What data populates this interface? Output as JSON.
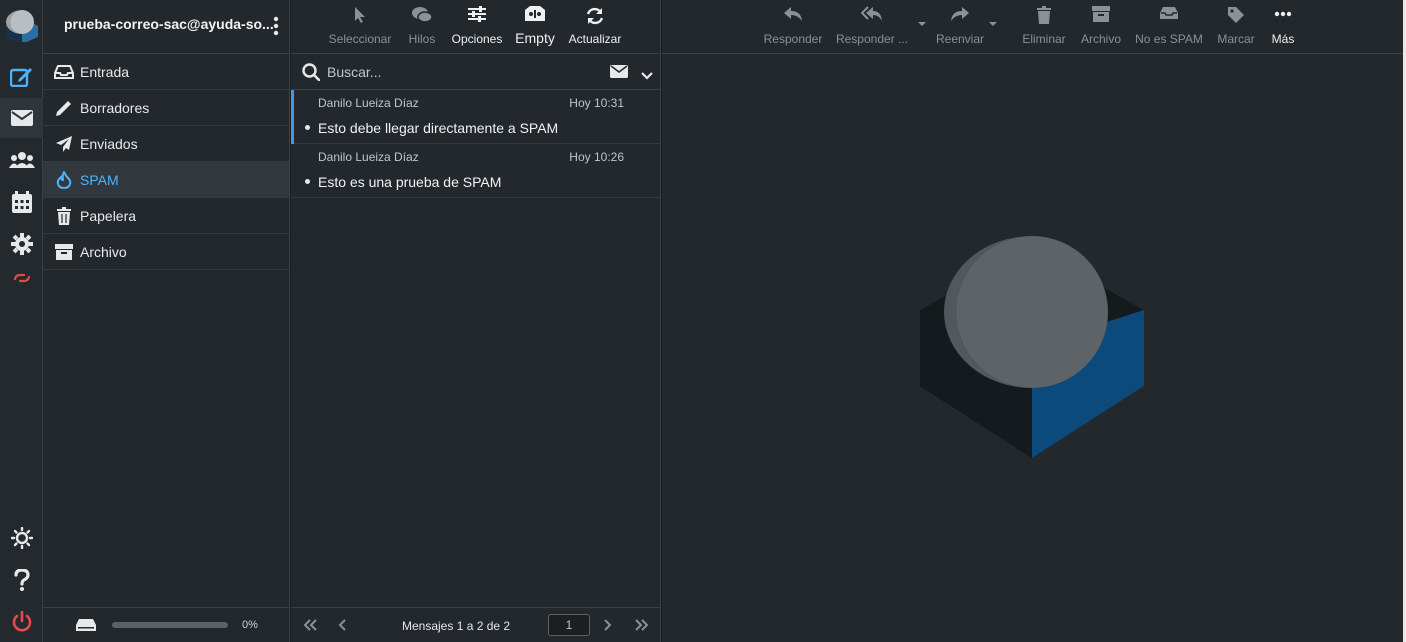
{
  "account": {
    "email": "prueba-correo-sac@ayuda-so..."
  },
  "rail": {
    "items": [
      "compose-icon",
      "mail-icon",
      "contacts-icon",
      "calendar-icon",
      "settings-icon",
      "cpanel-icon"
    ],
    "bottom": [
      "theme-icon",
      "help-icon",
      "logout-icon"
    ],
    "colors": {
      "active": "#4db3ff",
      "logout": "#e5484d",
      "cpanel": "#e5484d"
    }
  },
  "folders": {
    "items": [
      {
        "label": "Entrada",
        "icon": "inbox-icon"
      },
      {
        "label": "Borradores",
        "icon": "pencil-icon"
      },
      {
        "label": "Enviados",
        "icon": "paper-plane-icon"
      },
      {
        "label": "SPAM",
        "icon": "fire-icon",
        "selected": true
      },
      {
        "label": "Papelera",
        "icon": "trash-icon"
      },
      {
        "label": "Archivo",
        "icon": "archive-icon"
      }
    ],
    "quota": {
      "text": "0%",
      "value": 0
    }
  },
  "list_toolbar": {
    "select": "Seleccionar",
    "threads": "Hilos",
    "options": "Opciones",
    "empty": "Empty",
    "refresh": "Actualizar"
  },
  "search": {
    "placeholder": "Buscar..."
  },
  "messages": [
    {
      "from": "Danilo Lueiza Díaz",
      "date": "Hoy 10:31",
      "subject": "Esto debe llegar directamente a SPAM"
    },
    {
      "from": "Danilo Lueiza Díaz",
      "date": "Hoy 10:26",
      "subject": "Esto es una prueba de SPAM"
    }
  ],
  "list_footer": {
    "count": "Mensajes 1 a 2 de 2",
    "page": "1"
  },
  "content_toolbar": {
    "reply": "Responder",
    "reply_all": "Responder ...",
    "forward": "Reenviar",
    "delete": "Eliminar",
    "archive": "Archivo",
    "not_spam": "No es SPAM",
    "mark": "Marcar",
    "more": "Más"
  }
}
